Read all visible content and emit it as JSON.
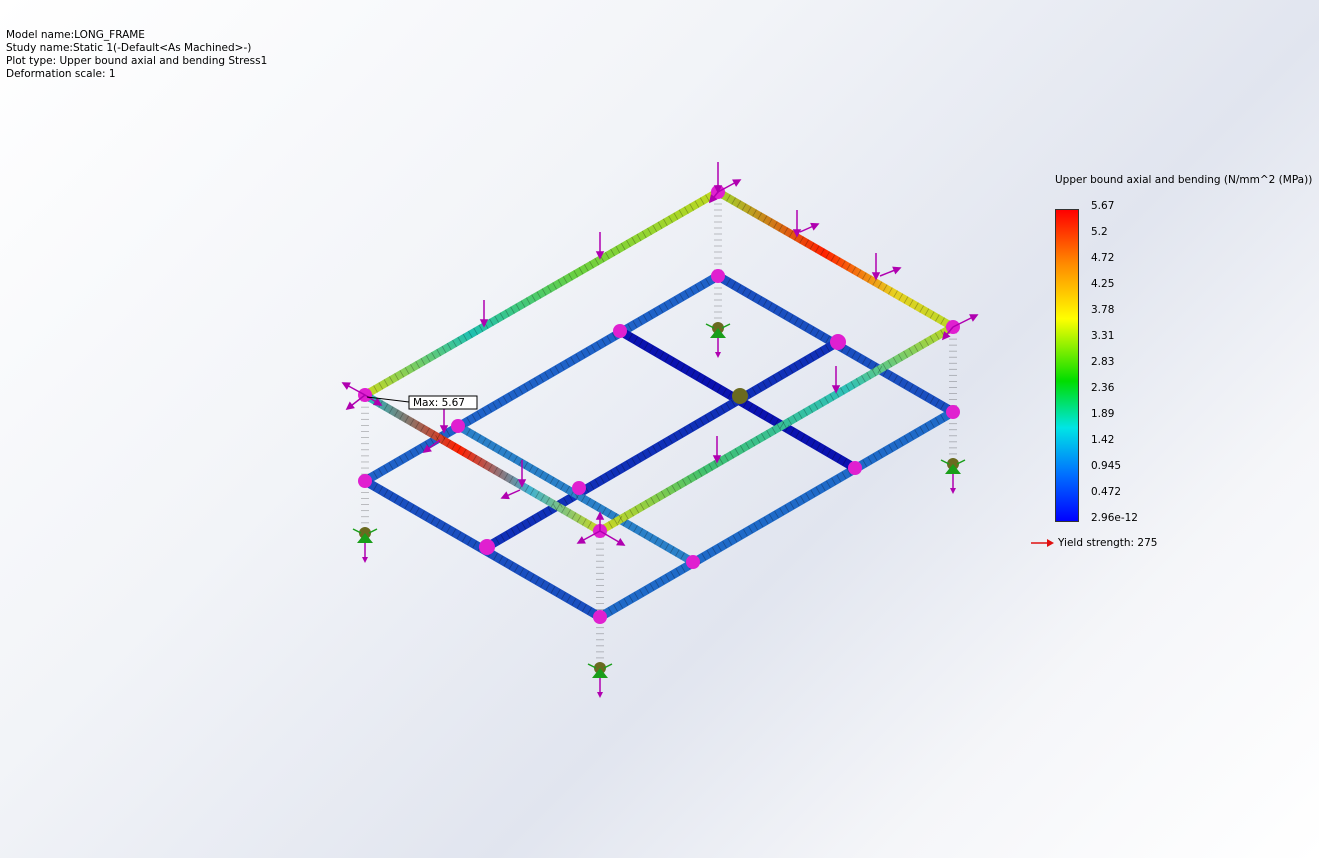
{
  "header": {
    "model_name": "Model name:LONG_FRAME",
    "study_name": "Study name:Static 1(-Default<As Machined>-)",
    "plot_type": "Plot type: Upper bound axial and bending Stress1",
    "deformation_scale": "Deformation scale: 1"
  },
  "legend": {
    "title": "Upper bound axial and bending (N/mm^2 (MPa))",
    "ticks": [
      "5.67",
      "5.2",
      "4.72",
      "4.25",
      "3.78",
      "3.31",
      "2.83",
      "2.36",
      "1.89",
      "1.42",
      "0.945",
      "0.472",
      "2.96e-12"
    ],
    "yield_label": "Yield strength: 275",
    "yield_color": "#e01010"
  },
  "viewport": {
    "max_label": "Max: 5.67",
    "joint_color": "#e020d0",
    "load_color": "#b000b0",
    "fixture_color": "#1a9e1a"
  }
}
